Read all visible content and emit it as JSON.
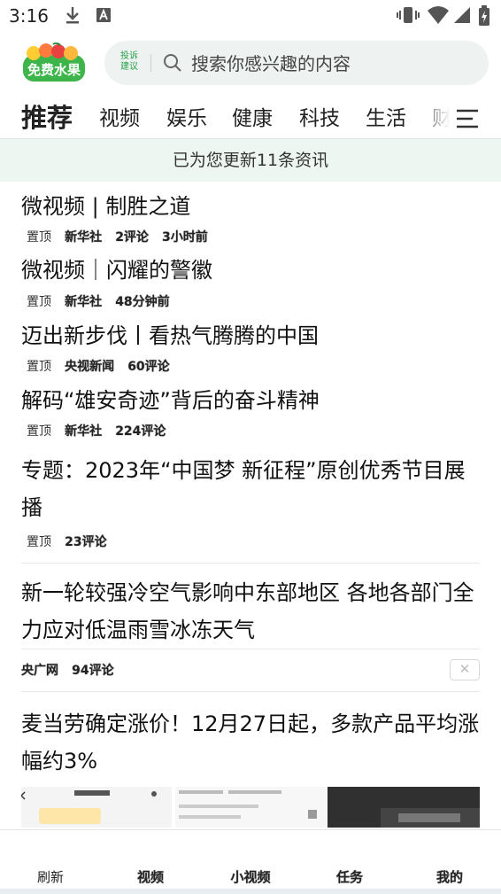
{
  "status_bar": {
    "time": "3:16",
    "icons": [
      "download-icon",
      "notification-a-icon",
      "vibrate-icon",
      "wifi-icon",
      "signal-icon",
      "battery-icon"
    ]
  },
  "header": {
    "logo_text": "免费水果",
    "tip_line1": "投诉",
    "tip_line2": "建议",
    "search_placeholder": "搜索你感兴趣的内容"
  },
  "tabs": [
    {
      "label": "推荐",
      "active": true
    },
    {
      "label": "视频"
    },
    {
      "label": "娱乐"
    },
    {
      "label": "健康"
    },
    {
      "label": "科技"
    },
    {
      "label": "生活"
    },
    {
      "label": "财"
    }
  ],
  "update_banner": "已为您更新11条资讯",
  "feed": [
    {
      "title": "微视频 | 制胜之道",
      "pin": "置顶",
      "source": "新华社",
      "comments": "2评论",
      "time": "3小时前"
    },
    {
      "title": "微视频｜闪耀的警徽",
      "pin": "置顶",
      "source": "新华社",
      "time": "48分钟前"
    },
    {
      "title": "迈出新步伐丨看热气腾腾的中国",
      "pin": "置顶",
      "source": "央视新闻",
      "comments": "60评论"
    },
    {
      "title": "解码“雄安奇迹”背后的奋斗精神",
      "pin": "置顶",
      "source": "新华社",
      "comments": "224评论"
    },
    {
      "title": "专题：2023年“中国梦 新征程”原创优秀节目展播",
      "pin": "置顶",
      "comments": "23评论"
    },
    {
      "title": "新一轮较强冷空气影响中东部地区  各地各部门全力应对低温雨雪冰冻天气",
      "source": "央广网",
      "comments": "94评论",
      "close": "✕"
    },
    {
      "title": "麦当劳确定涨价！12月27日起，多款产品平均涨幅约3%"
    }
  ],
  "bottom_nav": [
    {
      "label": "刷新"
    },
    {
      "label": "视频"
    },
    {
      "label": "小视频"
    },
    {
      "label": "任务"
    },
    {
      "label": "我的"
    }
  ],
  "colors": {
    "accent_green": "#27a046",
    "banner_bg": "#eef6f1",
    "search_bg": "#eef3f2"
  }
}
